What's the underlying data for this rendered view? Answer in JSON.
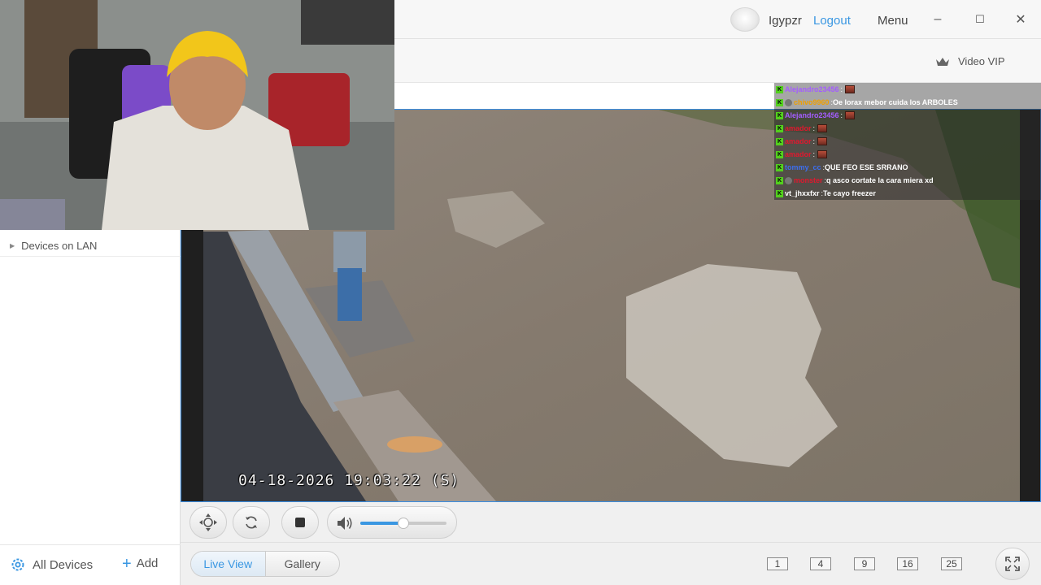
{
  "titlebar": {
    "username": "Igypzr",
    "logout_label": "Logout",
    "menu_label": "Menu",
    "minimize": "–",
    "maximize": "☐",
    "close": "✕"
  },
  "toolbar": {
    "vip_label": "Video VIP"
  },
  "sidebar": {
    "lan_label": "Devices on LAN",
    "all_devices_label": "All Devices",
    "add_label": "Add"
  },
  "video": {
    "timestamp": "04-18-2026 19:03:22 (S)"
  },
  "chat": {
    "messages": [
      {
        "user": "Alejandro23456",
        "text": "",
        "emote": true,
        "style": "hl",
        "color": "#a45cff"
      },
      {
        "user": "chivo9960",
        "text": "Oe lorax mebor cuida los ARBOLES",
        "emote": false,
        "style": "hl",
        "color": "#f0a000"
      },
      {
        "user": "Alejandro23456",
        "text": "",
        "emote": true,
        "style": "dark",
        "color": "#a45cff"
      },
      {
        "user": "amador",
        "text": "",
        "emote": true,
        "style": "dark",
        "color": "#e0182e"
      },
      {
        "user": "amador",
        "text": "",
        "emote": true,
        "style": "dark",
        "color": "#e0182e"
      },
      {
        "user": "amador",
        "text": "",
        "emote": true,
        "style": "dark",
        "color": "#e0182e"
      },
      {
        "user": "tommy_cc",
        "text": "QUE FEO ESE SRRANO",
        "emote": false,
        "style": "dark",
        "color": "#3c6ff0"
      },
      {
        "user": "monster",
        "text": "q asco cortate la cara miera xd",
        "emote": false,
        "style": "dark",
        "color": "#e0182e"
      },
      {
        "user": "vt_jhxxfxr",
        "text": "Te cayo freezer",
        "emote": false,
        "style": "dark",
        "color": "#ffffff"
      }
    ]
  },
  "controls": {
    "volume_level": 0.5
  },
  "bottombar": {
    "tab_live_view": "Live View",
    "tab_gallery": "Gallery",
    "layouts": [
      "1",
      "4",
      "9",
      "16",
      "25"
    ]
  },
  "colors": {
    "accent": "#3a97e2",
    "frame_border": "#3a8de0"
  }
}
